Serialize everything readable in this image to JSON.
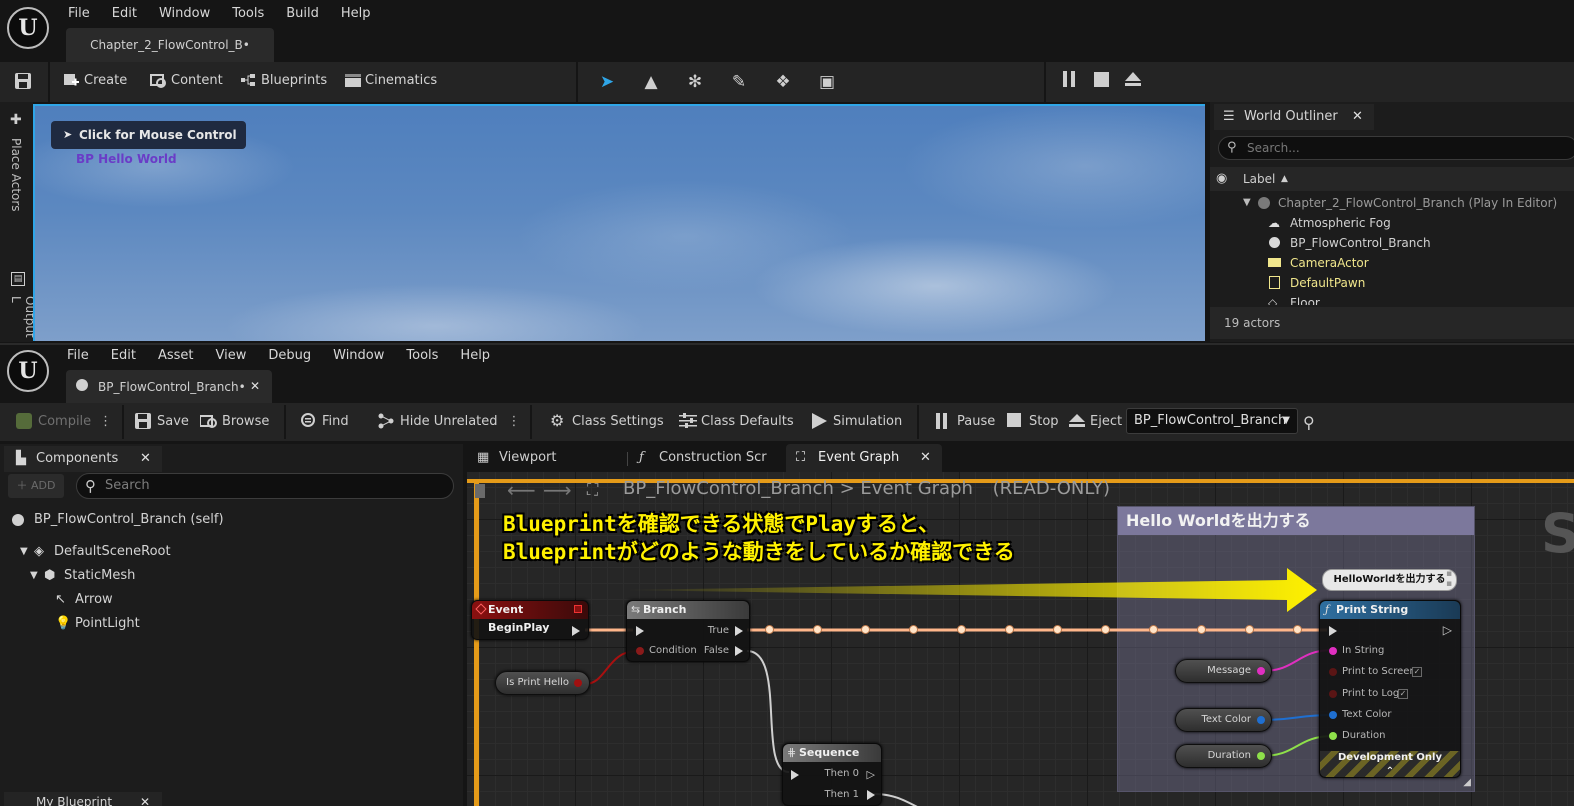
{
  "top_editor": {
    "logo": "U",
    "menu": [
      "File",
      "Edit",
      "Window",
      "Tools",
      "Build",
      "Help"
    ],
    "doc_tab": "Chapter_2_FlowControl_B•",
    "toolbar": {
      "create": "Create",
      "content": "Content",
      "blueprints": "Blueprints",
      "cinematics": "Cinematics"
    },
    "left_strip": {
      "place_actors": "Place Actors",
      "output_log": "Output L"
    },
    "viewport": {
      "mouse_control": "Click for Mouse Control",
      "hello_label": "BP Hello World"
    },
    "outliner": {
      "tab": "World Outliner",
      "search_placeholder": "Search...",
      "column": "Label",
      "rows": [
        {
          "label": "Chapter_2_FlowControl_Branch (Play In Editor)",
          "color": "#9a9a9a"
        },
        {
          "label": "Atmospheric Fog",
          "color": "#d2d2d2"
        },
        {
          "label": "BP_FlowControl_Branch",
          "color": "#d2d2d2"
        },
        {
          "label": "CameraActor",
          "color": "#f0e68c"
        },
        {
          "label": "DefaultPawn",
          "color": "#f0e68c"
        },
        {
          "label": "Floor",
          "color": "#d2d2d2"
        }
      ],
      "count": "19 actors"
    }
  },
  "bp_editor": {
    "menu": [
      "File",
      "Edit",
      "Asset",
      "View",
      "Debug",
      "Window",
      "Tools",
      "Help"
    ],
    "doc_tab": "BP_FlowControl_Branch•",
    "toolbar": {
      "compile": "Compile",
      "save": "Save",
      "browse": "Browse",
      "find": "Find",
      "hide_unrelated": "Hide Unrelated",
      "class_settings": "Class Settings",
      "class_defaults": "Class Defaults",
      "simulation": "Simulation",
      "pause": "Pause",
      "stop": "Stop",
      "eject": "Eject",
      "debug_object": "BP_FlowControl_Branch"
    },
    "components": {
      "tab": "Components",
      "add": "ADD",
      "search_placeholder": "Search",
      "tree": [
        "BP_FlowControl_Branch (self)",
        "DefaultSceneRoot",
        "StaticMesh",
        "Arrow",
        "PointLight"
      ]
    },
    "my_blueprint_tab": "My Blueprint",
    "graph_tabs": [
      "Viewport",
      "Construction Scri",
      "Event Graph"
    ],
    "breadcrumb": {
      "blueprint": "BP_FlowControl_Branch",
      "sep": ">",
      "graph": "Event Graph",
      "mode": "(READ-ONLY)"
    },
    "annotation": [
      "Blueprintを確認できる状態でPlayすると、",
      "Blueprintがどのような動きをしているか確認できる"
    ],
    "comment_box": "Hello Worldを出力する",
    "nodes": {
      "event_begin": "Event BeginPlay",
      "branch": {
        "title": "Branch",
        "true": "True",
        "condition": "Condition",
        "false": "False"
      },
      "is_print_hello": "Is Print Hello",
      "sequence": {
        "title": "Sequence",
        "then0": "Then 0",
        "then1": "Then 1"
      },
      "print_string": {
        "title": "Print String",
        "in_string": "In String",
        "print_to_screen": "Print to Screen",
        "print_to_log": "Print to Log",
        "text_color": "Text Color",
        "duration": "Duration",
        "dev_only": "Development Only"
      },
      "message": "Message",
      "text_color_var": "Text Color",
      "duration_var": "Duration",
      "bubble": "HelloWorldを出力する"
    },
    "colors": {
      "accent_orange": "#e59b19",
      "annotation_yellow": "#fff100",
      "exec_flow": "#ffb68a"
    }
  }
}
